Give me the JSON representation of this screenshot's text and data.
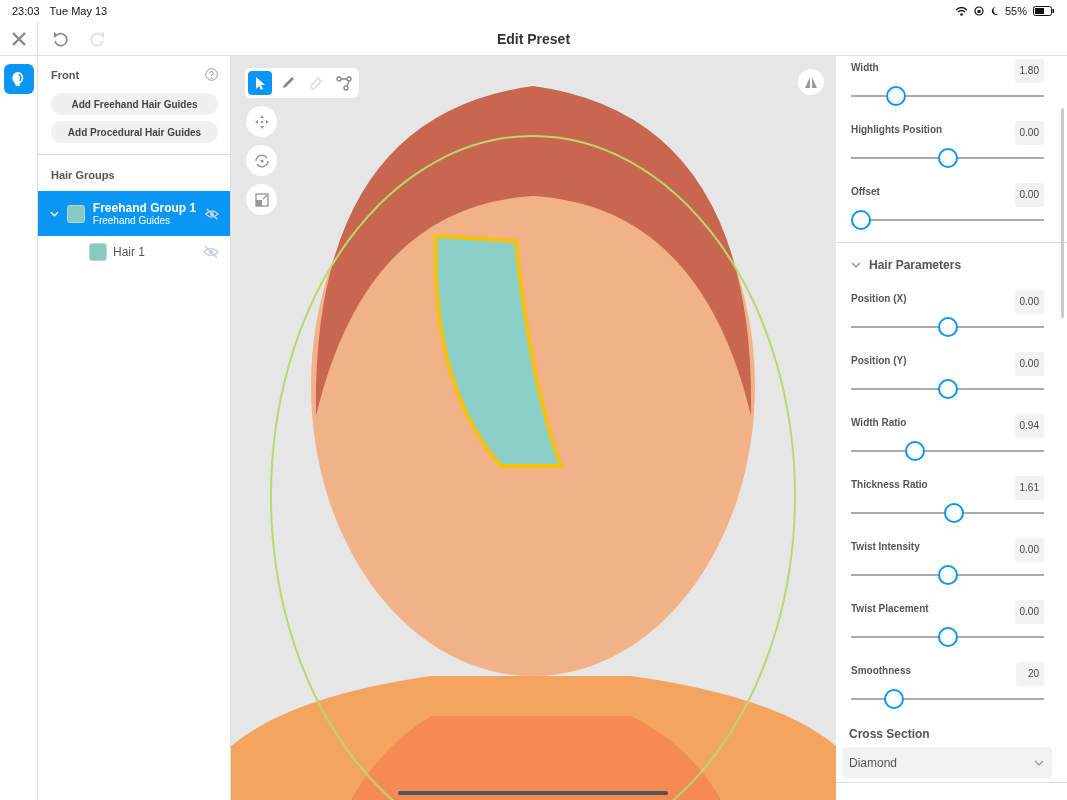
{
  "status_bar": {
    "time": "23:03",
    "date": "Tue May 13",
    "battery": "55%"
  },
  "header": {
    "title": "Edit Preset",
    "undo_disabled": false,
    "redo_disabled": true
  },
  "rail": {
    "items": [
      {
        "kind": "hair",
        "selected": true
      }
    ]
  },
  "left_panel": {
    "title": "Front",
    "buttons": [
      "Add Freehand Hair Guides",
      "Add Procedural Hair Guides"
    ],
    "groups_title": "Hair Groups",
    "groups": [
      {
        "name": "Freehand Group 1",
        "subtitle": "Freehand Guides",
        "selected": true,
        "expanded": true,
        "visible": false,
        "children": [
          {
            "name": "Hair 1",
            "selected": false,
            "visible": false
          }
        ]
      }
    ]
  },
  "viewport": {
    "tools": [
      {
        "kind": "select",
        "selected": true,
        "disabled": false
      },
      {
        "kind": "pen",
        "selected": false,
        "disabled": false
      },
      {
        "kind": "eraser",
        "selected": false,
        "disabled": true
      },
      {
        "kind": "path",
        "selected": false,
        "disabled": false
      }
    ],
    "transform_tools": [
      {
        "kind": "move"
      },
      {
        "kind": "rotate"
      },
      {
        "kind": "scale"
      }
    ]
  },
  "right_panel": {
    "sliders": [
      {
        "label": "Width",
        "value": "1.80",
        "level": 0.2
      },
      {
        "label": "Highlights Position",
        "value": "0.00",
        "level": 0.5
      },
      {
        "label": "Offset",
        "value": "0.00",
        "level": 0
      }
    ],
    "hair_parameters": {
      "title": "Hair Parameters",
      "expanded": true,
      "sliders": [
        {
          "label": "Position (X)",
          "value": "0.00",
          "level": 0.5
        },
        {
          "label": "Position (Y)",
          "value": "0.00",
          "level": 0.5
        },
        {
          "label": "Width Ratio",
          "value": "0.94",
          "level": 0.31
        },
        {
          "label": "Thickness Ratio",
          "value": "1.61",
          "level": 0.54
        },
        {
          "label": "Twist Intensity",
          "value": "0.00",
          "level": 0.5
        },
        {
          "label": "Twist Placement",
          "value": "0.00",
          "level": 0.5
        },
        {
          "label": "Smoothness",
          "value": "20",
          "level": 0.19
        }
      ]
    },
    "cross_section": {
      "label": "Cross Section",
      "value": "Diamond"
    }
  }
}
